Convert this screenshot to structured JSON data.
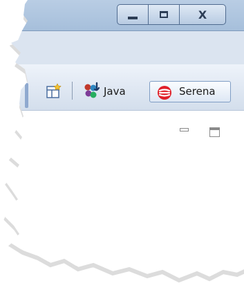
{
  "window": {
    "caption_buttons": {
      "minimize_icon": "minimize-icon",
      "maximize_icon": "maximize-icon",
      "close_glyph": "X"
    },
    "titlebar_color": "#a6bfdb"
  },
  "toolbar": {
    "open_perspective_icon": "open-perspective-icon",
    "java_icon": "java-perspective-icon",
    "java_label": "Java",
    "serena_icon": "serena-logo-icon",
    "serena_label": "Serena",
    "serena_color": "#e0202a"
  },
  "view": {
    "minimize_icon": "view-minimize-icon",
    "maximize_icon": "view-maximize-icon"
  }
}
